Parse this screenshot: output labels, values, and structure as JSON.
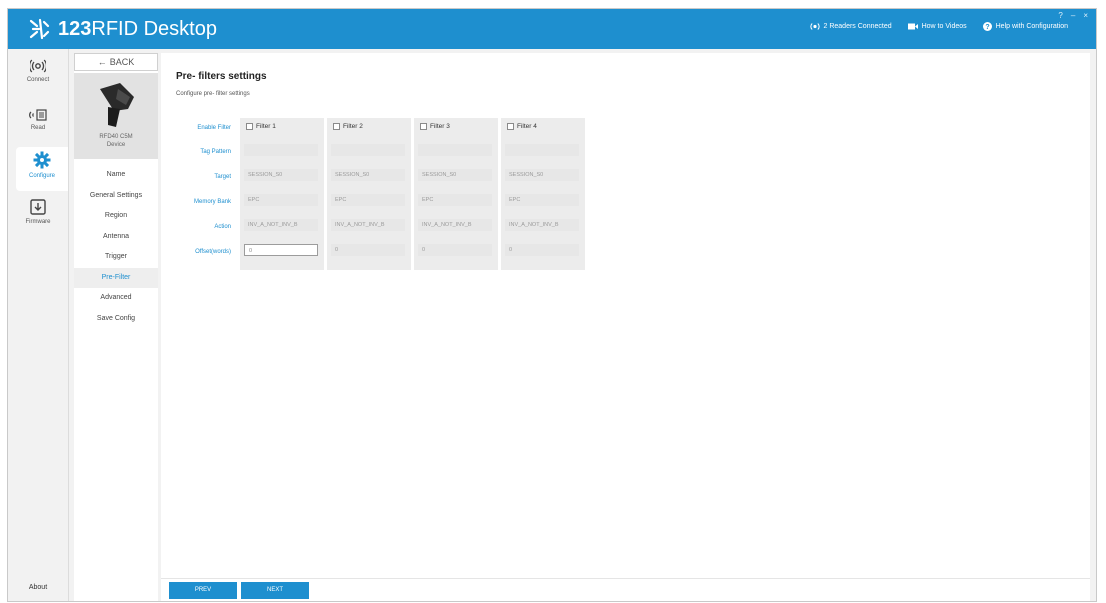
{
  "app": {
    "title_bold": "123",
    "title_rest": "RFID Desktop",
    "accent_color": "#1e8fcf",
    "logo_icon": "zebra-logo-icon",
    "header_actions": [
      {
        "label": "2 Readers Connected",
        "icon": "reader-icon"
      },
      {
        "label": "How to Videos",
        "icon": "video-icon"
      },
      {
        "label": "Help with Configuration",
        "icon": "help-icon"
      }
    ],
    "window_controls": [
      "?",
      "–",
      "×"
    ]
  },
  "rail": {
    "items": [
      {
        "label": "Connect",
        "icon": "wireless-icon"
      },
      {
        "label": "Read",
        "icon": "read-icon"
      },
      {
        "label": "Configure",
        "icon": "gear-icon"
      },
      {
        "label": "Firmware",
        "icon": "download-icon"
      }
    ],
    "active": "Configure",
    "about": "About"
  },
  "nav": {
    "back_label": "BACK",
    "device_name_line1": "RFD40 C5M",
    "device_name_line2": "Device",
    "items": [
      "Name",
      "General Settings",
      "Region",
      "Antenna",
      "Trigger",
      "Pre-Filter",
      "Advanced",
      "Save Config"
    ],
    "active": "Pre-Filter"
  },
  "page": {
    "title": "Pre- filters settings",
    "subtitle": "Configure pre- filter settings"
  },
  "grid": {
    "row_labels": [
      "Enable Filter",
      "Tag Pattern",
      "Target",
      "Memory Bank",
      "Action",
      "Offset(words)"
    ],
    "filters": [
      {
        "name": "Filter 1",
        "enabled": false,
        "tag_pattern": "",
        "target": "SESSION_S0",
        "memory_bank": "EPC",
        "action": "INV_A_NOT_INV_B",
        "offset": "0"
      },
      {
        "name": "Filter 2",
        "enabled": false,
        "tag_pattern": "",
        "target": "SESSION_S0",
        "memory_bank": "EPC",
        "action": "INV_A_NOT_INV_B",
        "offset": "0"
      },
      {
        "name": "Filter 3",
        "enabled": false,
        "tag_pattern": "",
        "target": "SESSION_S0",
        "memory_bank": "EPC",
        "action": "INV_A_NOT_INV_B",
        "offset": "0"
      },
      {
        "name": "Filter 4",
        "enabled": false,
        "tag_pattern": "",
        "target": "SESSION_S0",
        "memory_bank": "EPC",
        "action": "INV_A_NOT_INV_B",
        "offset": "0"
      }
    ]
  },
  "footer": {
    "prev_label": "PREV",
    "next_label": "NEXT"
  }
}
